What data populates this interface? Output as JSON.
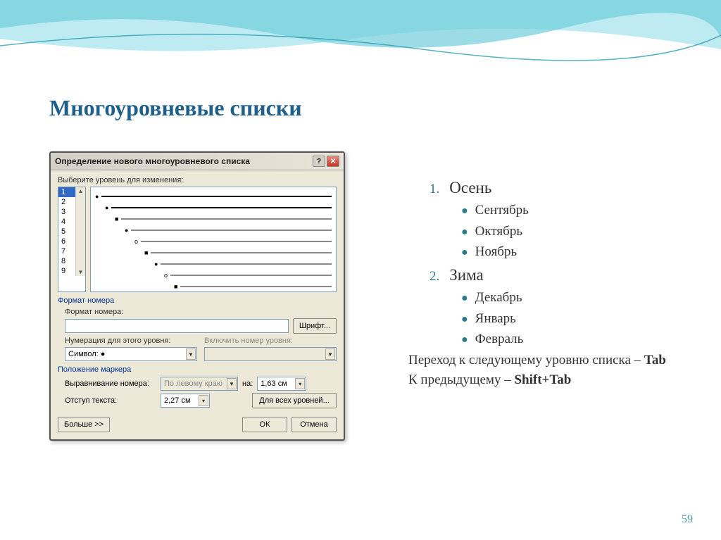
{
  "slide": {
    "title": "Многоуровневые списки",
    "page_number": "59"
  },
  "dialog": {
    "title": "Определение нового многоуровневого списка",
    "help_icon": "?",
    "close_icon": "✕",
    "level_select_label": "Выберите уровень для изменения:",
    "levels": [
      "1",
      "2",
      "3",
      "4",
      "5",
      "6",
      "7",
      "8",
      "9"
    ],
    "selected_level": "1",
    "format_section": "Формат номера",
    "format_label": "Формат номера:",
    "format_value": "",
    "font_button": "Шрифт...",
    "numbering_label": "Нумерация для этого уровня:",
    "numbering_value": "Символ: ●",
    "include_level_label": "Включить номер уровня:",
    "marker_section": "Положение маркера",
    "align_label": "Выравнивание номера:",
    "align_value": "По левому краю",
    "at_label": "на:",
    "at_value": "1,63 см",
    "indent_label": "Отступ текста:",
    "indent_value": "2,27 см",
    "all_levels_button": "Для всех уровней...",
    "more_button": "Больше >>",
    "ok_button": "ОК",
    "cancel_button": "Отмена"
  },
  "list": {
    "items": [
      {
        "num": "1.",
        "text": "Осень",
        "sub": [
          "Сентябрь",
          "Октябрь",
          "Ноябрь"
        ]
      },
      {
        "num": "2.",
        "text": "Зима",
        "sub": [
          "Декабрь",
          "Январь",
          "Февраль"
        ]
      }
    ],
    "note1_a": "Переход к следующему уровню списка – ",
    "note1_b": "Tab",
    "note2_a": "К предыдущему – ",
    "note2_b": "Shift+Tab"
  }
}
